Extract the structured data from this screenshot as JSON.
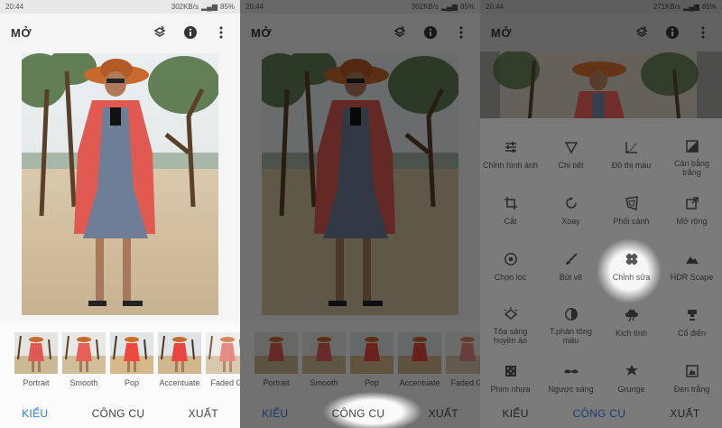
{
  "panels": [
    {
      "status": {
        "time": "20:44",
        "speed": "302KB/s",
        "battery": "85%"
      },
      "topbar": {
        "title": "MỞ"
      },
      "filters": [
        "Portrait",
        "Smooth",
        "Pop",
        "Accentuate",
        "Faded Gl"
      ],
      "nav": {
        "looks": "KIỂU",
        "tools": "CÔNG CỤ",
        "export": "XUẤT"
      }
    },
    {
      "status": {
        "time": "20:44",
        "speed": "302KB/s",
        "battery": "85%"
      },
      "topbar": {
        "title": "MỞ"
      },
      "filters": [
        "Portrait",
        "Smooth",
        "Pop",
        "Accentuate",
        "Faded Gl"
      ],
      "nav": {
        "looks": "KIỂU",
        "tools": "CÔNG CỤ",
        "export": "XUẤT"
      }
    },
    {
      "status": {
        "time": "20:44",
        "speed": "271KB/s",
        "battery": "85%"
      },
      "topbar": {
        "title": "MỞ"
      },
      "tools": [
        {
          "label": "Chỉnh hình ảnh",
          "icon": "tune-icon"
        },
        {
          "label": "Chi tiết",
          "icon": "details-icon"
        },
        {
          "label": "Đồ thị màu",
          "icon": "curves-icon"
        },
        {
          "label": "Cân bằng trắng",
          "icon": "white-balance-icon"
        },
        {
          "label": "Cắt",
          "icon": "crop-icon"
        },
        {
          "label": "Xoay",
          "icon": "rotate-icon"
        },
        {
          "label": "Phối cảnh",
          "icon": "perspective-icon"
        },
        {
          "label": "Mở rộng",
          "icon": "expand-icon"
        },
        {
          "label": "Chọn lọc",
          "icon": "selective-icon"
        },
        {
          "label": "Bút vẽ",
          "icon": "brush-icon"
        },
        {
          "label": "Chỉnh sửa",
          "icon": "healing-icon"
        },
        {
          "label": "HDR Scape",
          "icon": "hdr-icon"
        },
        {
          "label": "Tỏa sáng huyền ảo",
          "icon": "glamour-glow-icon"
        },
        {
          "label": "T.phản tông màu",
          "icon": "tonal-contrast-icon"
        },
        {
          "label": "Kịch tính",
          "icon": "drama-icon"
        },
        {
          "label": "Cổ điển",
          "icon": "vintage-icon"
        },
        {
          "label": "Phim nhựa",
          "icon": "grainy-film-icon"
        },
        {
          "label": "Ngược sáng",
          "icon": "retrolux-icon"
        },
        {
          "label": "Grunge",
          "icon": "grunge-icon"
        },
        {
          "label": "Đen trắng",
          "icon": "black-white-icon"
        }
      ],
      "nav": {
        "looks": "KIỂU",
        "tools": "CÔNG CỤ",
        "export": "XUẤT"
      }
    }
  ],
  "colors": {
    "accent": "#2c7be5",
    "cardigan": "#e05a52",
    "hat": "#c8692e"
  }
}
